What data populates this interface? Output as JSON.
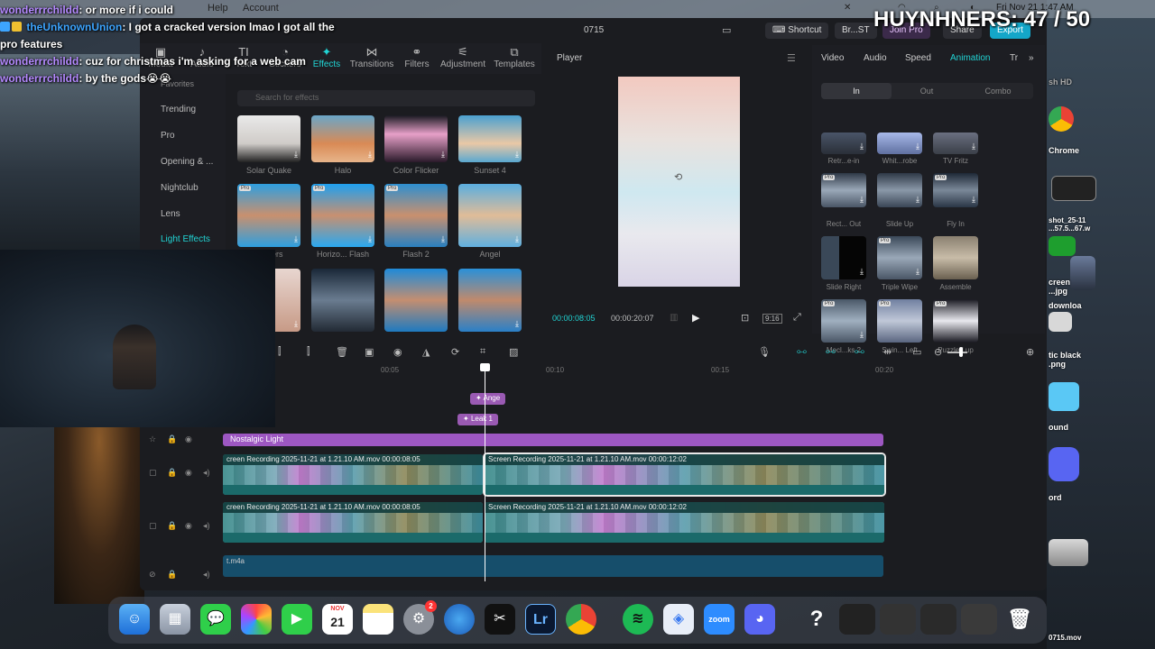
{
  "menubar": {
    "help": "Help",
    "account": "Account",
    "datetime": "Fri Nov 21 1:47 AM"
  },
  "app": {
    "title": "0715",
    "shortcut": "Shortcut",
    "profile": "Br...ST",
    "join_pro": "Join Pro",
    "share": "Share",
    "export": "Export"
  },
  "media_tabs": [
    {
      "label": "Media",
      "icon": "media-icon"
    },
    {
      "label": "Audio",
      "icon": "audio-icon"
    },
    {
      "label": "Text",
      "icon": "text-icon"
    },
    {
      "label": "Stickers",
      "icon": "stickers-icon"
    },
    {
      "label": "Effects",
      "icon": "effects-icon"
    },
    {
      "label": "Transitions",
      "icon": "transitions-icon"
    },
    {
      "label": "Filters",
      "icon": "filters-icon"
    },
    {
      "label": "Adjustment",
      "icon": "adjustment-icon"
    },
    {
      "label": "Templates",
      "icon": "templates-icon"
    }
  ],
  "effects_sidebar": [
    "Favorites",
    "Trending",
    "Pro",
    "Opening & ...",
    "Nightclub",
    "Lens",
    "Light Effects"
  ],
  "effects_search_placeholder": "Search for effects",
  "effects": [
    {
      "label": "Solar Quake"
    },
    {
      "label": "Halo"
    },
    {
      "label": "Color Flicker"
    },
    {
      "label": "Sunset 4"
    },
    {
      "label": "...ickers"
    },
    {
      "label": "Horizo... Flash"
    },
    {
      "label": "Flash 2"
    },
    {
      "label": "Angel"
    }
  ],
  "player": {
    "title": "Player",
    "time_current": "00:00:08:05",
    "time_total": "00:00:20:07",
    "ratio": "9:16"
  },
  "right_panel": {
    "tabs": [
      "Video",
      "Audio",
      "Speed",
      "Animation",
      "Tr"
    ],
    "segments": [
      "In",
      "Out",
      "Combo"
    ],
    "animations": [
      {
        "label": "Retr...e-in"
      },
      {
        "label": "Whit...robe"
      },
      {
        "label": "TV Fritz"
      },
      {
        "label": "Rect... Out"
      },
      {
        "label": "Slide Up"
      },
      {
        "label": "Fly In"
      },
      {
        "label": "Slide Right"
      },
      {
        "label": "Triple Wipe"
      },
      {
        "label": "Assemble"
      },
      {
        "label": "Mecl...ks 2"
      },
      {
        "label": "Swin... Left"
      },
      {
        "label": "Puzzled up"
      }
    ],
    "pro_badge": "Pro"
  },
  "timeline": {
    "ruler": [
      "00:05",
      "00:10",
      "00:15",
      "00:20"
    ],
    "effect_tags": [
      "Ange",
      "Leak 1"
    ],
    "filter": "Nostalgic Light",
    "clip_a_label": "creen Recording 2025-11-21 at 1.21.10 AM.mov  00:00:08:05",
    "clip_b_label": "Screen Recording 2025-11-21 at 1.21.10 AM.mov  00:00:12:02",
    "audio_label": "t.m4a"
  },
  "chat": [
    {
      "user": "wonderrrchildd",
      "text": ": or more if i could"
    },
    {
      "user": "theUnknownUnion",
      "text": ": I got a cracked version lmao I got all the pro features"
    },
    {
      "user": "wonderrrchildd",
      "text": ": cuz for christmas i'm asking for a web cam"
    },
    {
      "user": "wonderrrchildd",
      "text": ": by the gods😭😭"
    }
  ],
  "counter": "HUYNHNERS: 47 / 50",
  "desktop_labels": {
    "hd": "sh HD",
    "chrome": "Chrome",
    "shot": "shot_25-11\n...57.5...67.w",
    "screen": "creen\n...jpg",
    "downloads": "downloa",
    "black": "tic black\n.png",
    "sound": "ound",
    "discord": "ord",
    "video": "0715.mov"
  },
  "dock": {
    "calendar_day": "21",
    "calendar_month": "NOV",
    "lightroom": "Lr",
    "zoom": "zoom",
    "help": "?",
    "badge": "2"
  },
  "colors": {
    "accent": "#21d4d4",
    "filter_purple": "#9d57c2",
    "export_blue": "#14a6c9"
  }
}
